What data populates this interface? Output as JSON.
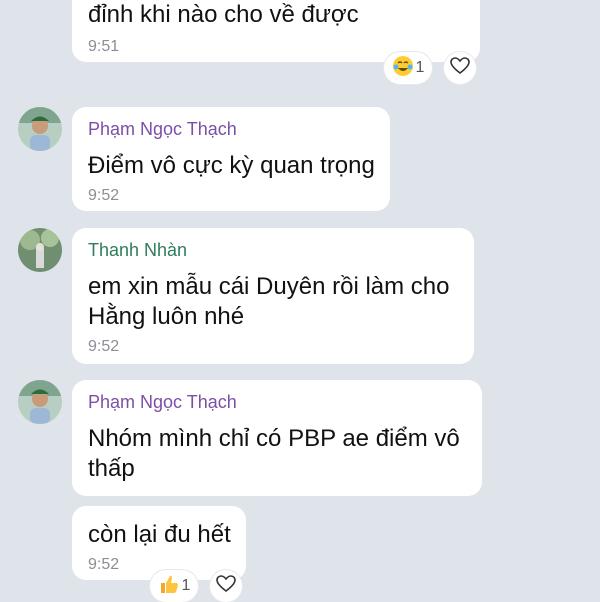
{
  "colors": {
    "background": "#dfe3ea",
    "bubble": "#ffffff",
    "sender_purple": "#7b4fa8",
    "sender_green": "#2e7d5b",
    "time": "#8a8f96"
  },
  "messages": [
    {
      "sender": "",
      "text": "đỉnh khi nào cho về được",
      "time": "9:51",
      "reaction": {
        "icon": "crying-laugh-emoji-icon",
        "count": "1"
      }
    },
    {
      "sender": "Phạm Ngọc Thạch",
      "sender_color": "purple",
      "text": "Điểm vô cực kỳ quan trọng",
      "time": "9:52"
    },
    {
      "sender": "Thanh Nhàn",
      "sender_color": "green",
      "text": "em xin mẫu cái Duyên rồi làm cho\nHằng luôn nhé",
      "time": "9:52"
    },
    {
      "sender": "Phạm Ngọc Thạch",
      "sender_color": "purple",
      "text": "Nhóm mình chỉ có PBP ae điểm vô\nthấp",
      "time": ""
    },
    {
      "sender": "",
      "text": "còn lại đu hết",
      "time": "9:52",
      "reaction": {
        "icon": "thumbs-up-emoji-icon",
        "count": "1"
      }
    }
  ]
}
